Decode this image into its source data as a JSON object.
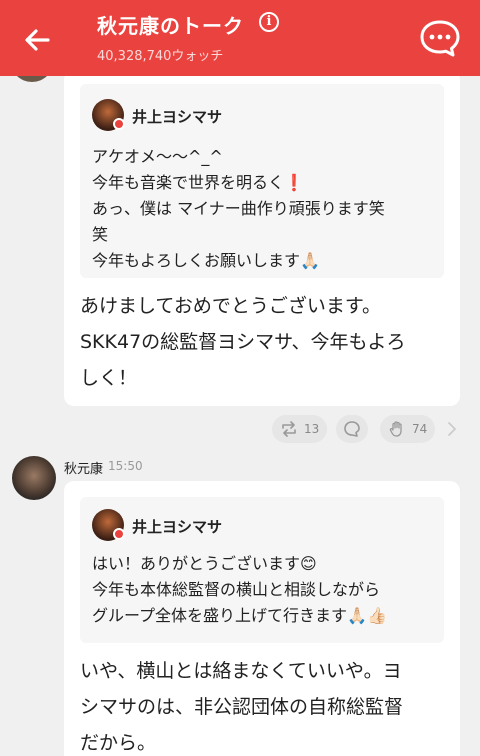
{
  "header": {
    "title": "秋元康のトーク",
    "info_icon": "ⓘ",
    "subtitle": "40,328,740ウォッチ",
    "accent_color": "#e9423f"
  },
  "post1": {
    "quote": {
      "author": "井上ヨシマサ",
      "lines": [
        "アケオメ〜〜^_^",
        "今年も音楽で世界を明るく❗",
        "あっ、僕は マイナー曲作り頑張ります笑",
        "笑",
        "今年もよろしくお願いします🙏🏻"
      ]
    },
    "body_lines": [
      "あけましておめでとうございます。",
      "SKK47の総監督ヨシマサ、今年もよろ",
      "しく！"
    ],
    "actions": {
      "repost_count": "13",
      "like_count": "74"
    }
  },
  "post2": {
    "author": "秋元康",
    "time": "15:50",
    "quote": {
      "author": "井上ヨシマサ",
      "lines": [
        "はい！ありがとうございます😊",
        "今年も本体総監督の横山と相談しながら",
        "グループ全体を盛り上げて行きます🙏🏻👍🏻"
      ]
    },
    "body_lines": [
      "いや、横山とは絡まなくていいや。ヨ",
      "シマサのは、非公認団体の自称総監督",
      "だから。"
    ]
  }
}
